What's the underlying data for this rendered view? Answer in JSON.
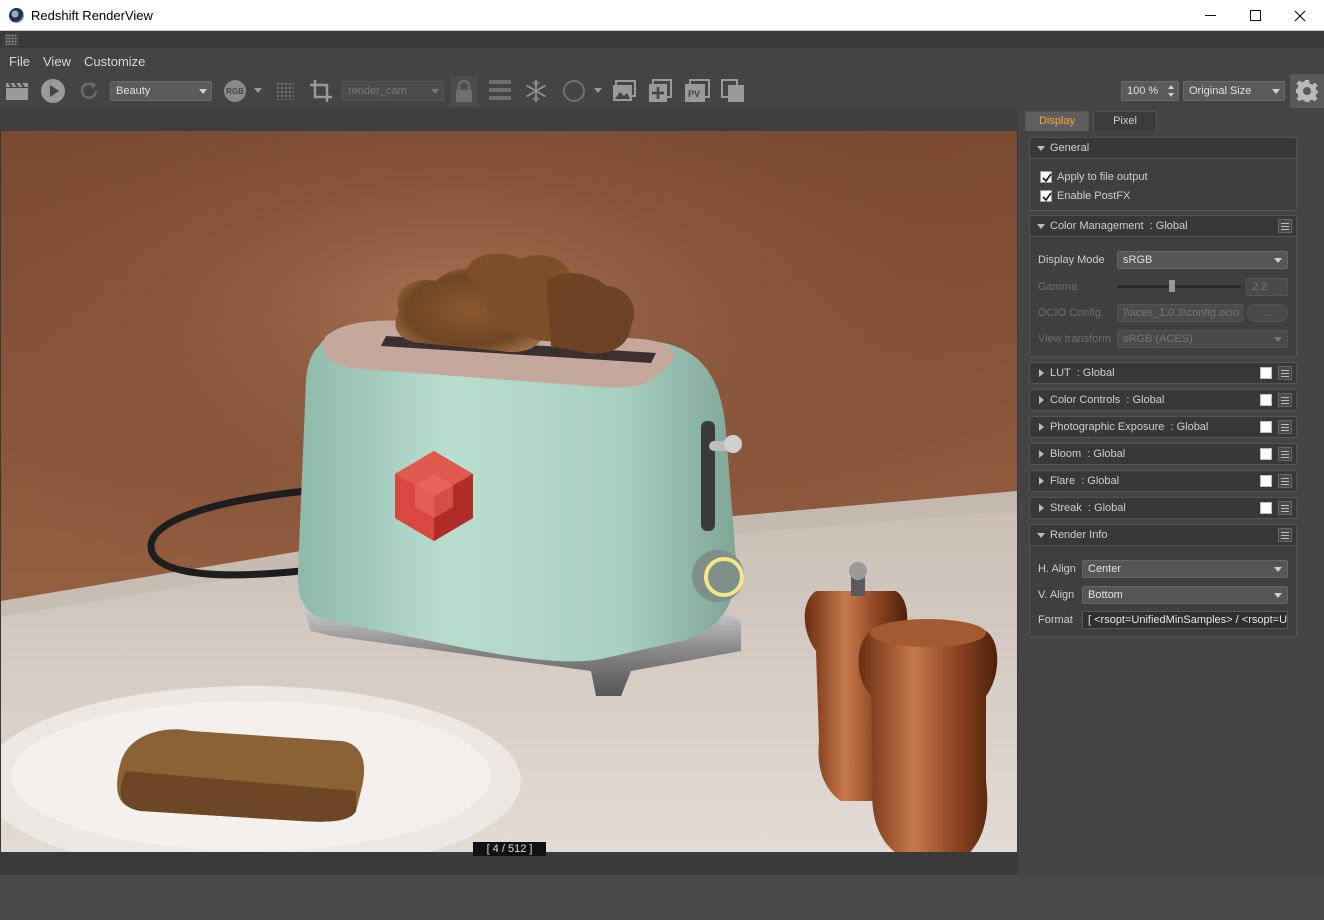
{
  "window": {
    "title": "Redshift RenderView"
  },
  "menu": {
    "items": [
      "File",
      "View",
      "Customize"
    ]
  },
  "toolbar": {
    "aov_dropdown": "Beauty",
    "channel_badge": "RGB",
    "camera_dropdown": "render_cam",
    "zoom_value": "100 %",
    "size_dropdown": "Original Size",
    "icons": [
      "clapper-icon",
      "play-icon",
      "refresh-icon",
      "rgb-channel-icon",
      "grid-dots-icon",
      "crop-icon",
      "lock-icon",
      "bucket-grid-icon",
      "snowflake-icon",
      "circle-icon",
      "image-icon",
      "add-snapshot-icon",
      "pv-icon",
      "copy-icon",
      "gear-icon"
    ]
  },
  "render": {
    "progress_text": "[ 4 / 512 ]"
  },
  "panel": {
    "tabs": [
      {
        "label": "Display",
        "active": true
      },
      {
        "label": "Pixel",
        "active": false
      }
    ],
    "general": {
      "header": "General",
      "apply_to_file_output": "Apply to file output",
      "apply_checked": true,
      "enable_postfx": "Enable PostFX",
      "postfx_checked": true
    },
    "color_management": {
      "header": "Color Management  : Global",
      "display_mode_label": "Display Mode",
      "display_mode_value": "sRGB",
      "gamma_label": "Gamma",
      "gamma_value": "2.2",
      "gamma_slider": 0.44,
      "ocio_label": "OCIO Config",
      "ocio_value": ")\\aces_1.0.3\\config.ocio",
      "ocio_browse": "...",
      "view_transform_label": "View transform",
      "view_transform_value": "sRGB (ACES)"
    },
    "collapsed_sections": [
      {
        "label": "LUT  : Global",
        "enabled": false
      },
      {
        "label": "Color Controls  : Global",
        "enabled": false
      },
      {
        "label": "Photographic Exposure  : Global",
        "enabled": false
      },
      {
        "label": "Bloom  : Global",
        "enabled": false
      },
      {
        "label": "Flare  : Global",
        "enabled": false
      },
      {
        "label": "Streak  : Global",
        "enabled": false
      }
    ],
    "render_info": {
      "header": "Render Info",
      "h_align_label": "H. Align",
      "h_align_value": "Center",
      "v_align_label": "V. Align",
      "v_align_value": "Bottom",
      "format_label": "Format",
      "format_value": "[ <rsopt=UnifiedMinSamples> / <rsopt=U"
    }
  },
  "colors": {
    "accent_tab": "#f2a536",
    "panel_bg": "#444444",
    "toaster": "#a9d0c0",
    "logo": "#d23a36"
  }
}
